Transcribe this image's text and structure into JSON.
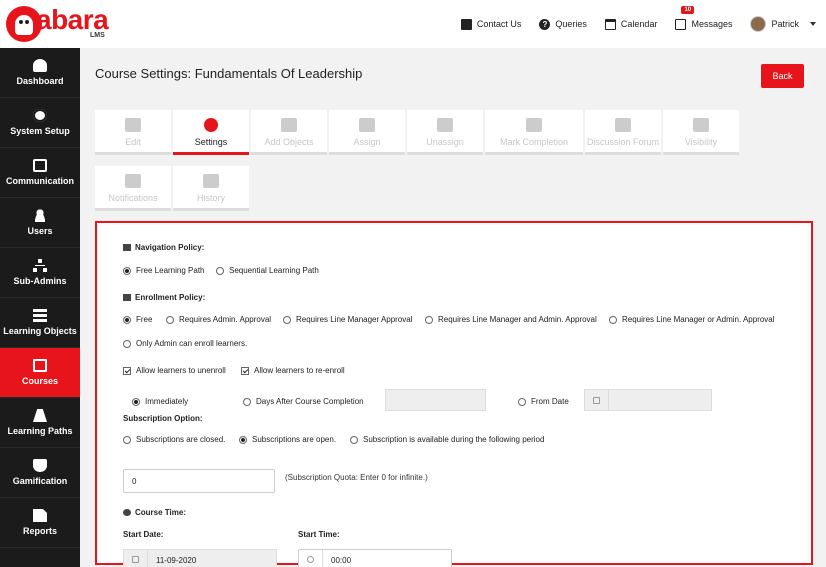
{
  "brand": {
    "name": "abara",
    "sub": "LMS"
  },
  "topnav": {
    "contact": "Contact Us",
    "queries": "Queries",
    "calendar": "Calendar",
    "messages": "Messages",
    "messages_count": "10",
    "user": "Patrick"
  },
  "sidebar": {
    "items": [
      {
        "label": "Dashboard",
        "icon": "dashboard-icon"
      },
      {
        "label": "System Setup",
        "icon": "gear-icon"
      },
      {
        "label": "Communication",
        "icon": "inbox-icon"
      },
      {
        "label": "Users",
        "icon": "users-icon"
      },
      {
        "label": "Sub-Admins",
        "icon": "sitemap-icon"
      },
      {
        "label": "Learning Objects",
        "icon": "server-icon"
      },
      {
        "label": "Courses",
        "icon": "desktop-icon"
      },
      {
        "label": "Learning Paths",
        "icon": "road-icon"
      },
      {
        "label": "Gamification",
        "icon": "trophy-icon"
      },
      {
        "label": "Reports",
        "icon": "file-icon"
      }
    ],
    "active": "Courses"
  },
  "page": {
    "title": "Course Settings: Fundamentals Of Leadership",
    "back_label": "Back"
  },
  "tabs": [
    "Edit",
    "Settings",
    "Add Objects",
    "Assign",
    "Unassign",
    "Mark Completion",
    "Discussion Forum",
    "Visibility",
    "Notifications",
    "History"
  ],
  "form": {
    "navigation_policy": {
      "label": "Navigation Policy:",
      "options": [
        "Free Learning Path",
        "Sequential Learning Path"
      ],
      "selected": "Free Learning Path"
    },
    "enrollment_policy": {
      "label": "Enrollment Policy:",
      "options": [
        "Free",
        "Requires Admin. Approval",
        "Requires Line Manager Approval",
        "Requires Line Manager and Admin. Approval",
        "Requires Line Manager or Admin. Approval",
        "Only Admin can enroll learners."
      ],
      "selected": "Free"
    },
    "checks": {
      "unenroll": "Allow learners to unenroll",
      "reenroll": "Allow learners to re-enroll"
    },
    "timing": {
      "immediately": "Immediately",
      "days_after": "Days After Course Completion",
      "from_date": "From Date"
    },
    "subscription": {
      "label": "Subscription Option:",
      "options": [
        "Subscriptions are closed.",
        "Subscriptions are open.",
        "Subscription is available during the following period"
      ],
      "selected": "Subscriptions are open."
    },
    "quota": {
      "value": "0",
      "note": "(Subscription Quota: Enter 0 for infinite.)"
    },
    "course_time": {
      "label": "Course Time:",
      "start_date_label": "Start Date:",
      "start_date": "11-09-2020",
      "start_time_label": "Start Time:",
      "start_time": "00:00"
    }
  }
}
